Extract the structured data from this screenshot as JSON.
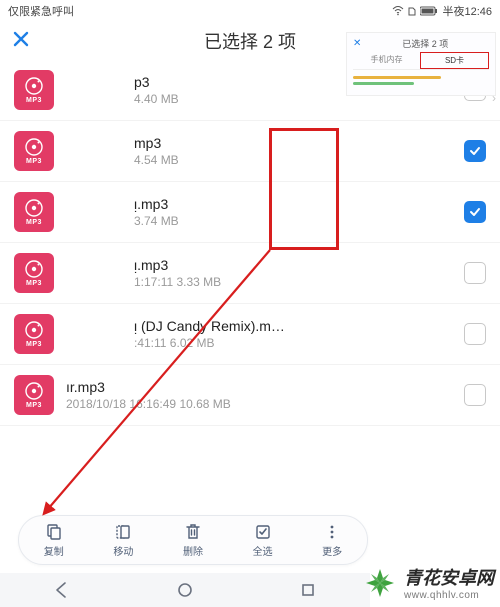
{
  "status": {
    "left": "仅限紧急呼叫",
    "time": "半夜12:46"
  },
  "header": {
    "title": "已选择 2 项"
  },
  "files": [
    {
      "name": "p3",
      "sub": "4.40 MB",
      "checked": false
    },
    {
      "name": "mp3",
      "sub": "4.54 MB",
      "checked": true
    },
    {
      "name": "ᴉ.mp3",
      "sub": "                     3.74 MB",
      "checked": true
    },
    {
      "name": "ᴉ.mp3",
      "sub": "1:17:11 3.33 MB",
      "checked": false
    },
    {
      "name": "ᴉ (DJ Candy Remix).m…",
      "sub": ":41:11 6.02 MB",
      "checked": false
    },
    {
      "name": "ır.mp3",
      "sub": "2018/10/18 16:16:49 10.68 MB",
      "checked": false
    }
  ],
  "thumb_label": "MP3",
  "toolbar": {
    "copy": "复制",
    "move": "移动",
    "delete": "删除",
    "select": "全选",
    "more": "更多"
  },
  "preview": {
    "title": "已选择 2 项",
    "tab_left": "手机内存",
    "tab_right": "SD卡"
  },
  "brand": {
    "cn": "青花安卓网",
    "url": "www.qhhlv.com"
  }
}
